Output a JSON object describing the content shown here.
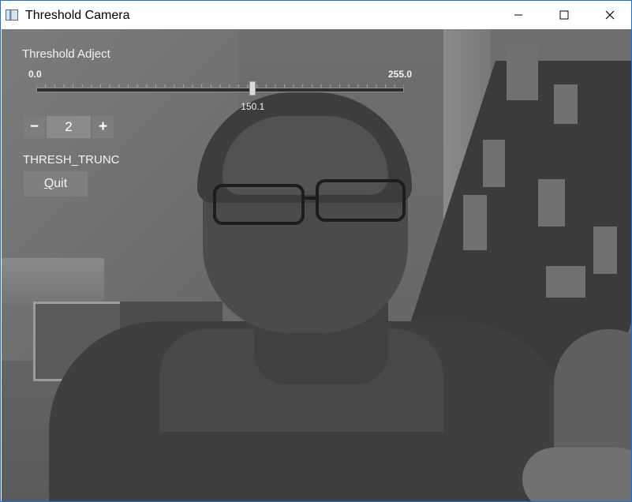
{
  "window": {
    "title": "Threshold Camera",
    "icon": "app-window-icon",
    "controls": [
      "minimize-icon",
      "maximize-icon",
      "close-icon"
    ]
  },
  "overlay": {
    "trackbar": {
      "label": "Threshold Adject",
      "min_label": "0.0",
      "max_label": "255.0",
      "min": 0,
      "max": 255,
      "value": 150.1,
      "value_label": "150.1"
    },
    "spinner": {
      "minus_label": "−",
      "value": "2",
      "plus_label": "+"
    },
    "mode_label": "THRESH_TRUNC",
    "quit_button": {
      "mnemonic": "Q",
      "rest": "uit"
    }
  },
  "colors": {
    "window_border": "#1e6fd0",
    "overlay_text": "#f2f2f2",
    "button_bg": "#7e807f"
  }
}
